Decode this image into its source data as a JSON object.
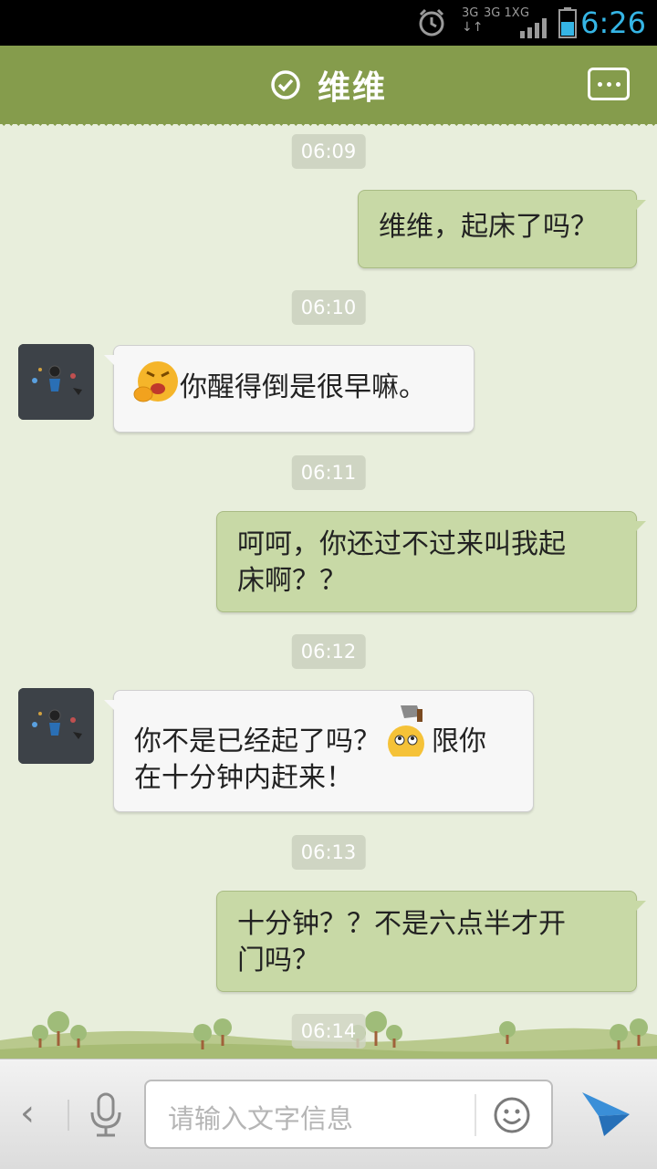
{
  "status_bar": {
    "network_1": "3G",
    "network_2": "3G 1X",
    "network_3": "G",
    "time": "6:26"
  },
  "header": {
    "title": "维维",
    "status_icon": "check-circle-icon",
    "menu_icon": "more-icon"
  },
  "messages": [
    {
      "type": "time",
      "text": "06:09"
    },
    {
      "type": "out",
      "text": "维维，起床了吗？"
    },
    {
      "type": "time",
      "text": "06:10"
    },
    {
      "type": "in",
      "emoji": "yawn-emoji-icon",
      "text": "你醒得倒是很早嘛。"
    },
    {
      "type": "time",
      "text": "06:11"
    },
    {
      "type": "out",
      "line1": "呵呵，你还过不过来叫我起",
      "line2": "床啊？？"
    },
    {
      "type": "time",
      "text": "06:12"
    },
    {
      "type": "in",
      "line1_a": "你不是已经起了吗？",
      "emoji": "axe-face-emoji-icon",
      "line1_b": "限你",
      "line2": "在十分钟内赶来！"
    },
    {
      "type": "time",
      "text": "06:13"
    },
    {
      "type": "out",
      "line1": "十分钟？？不是六点半才开",
      "line2": "门吗？"
    },
    {
      "type": "time",
      "text": "06:14"
    }
  ],
  "input_bar": {
    "back_icon": "chevron-left-icon",
    "back_glyph": "‹",
    "mic_icon": "microphone-icon",
    "placeholder": "请输入文字信息",
    "emoji_icon": "smiley-icon",
    "send_icon": "send-icon"
  },
  "colors": {
    "header": "#859c4c",
    "background": "#e8eedc",
    "bubble_out": "#c8d9a6",
    "bubble_in": "#f7f7f7",
    "time_accent": "#35b5e5"
  }
}
